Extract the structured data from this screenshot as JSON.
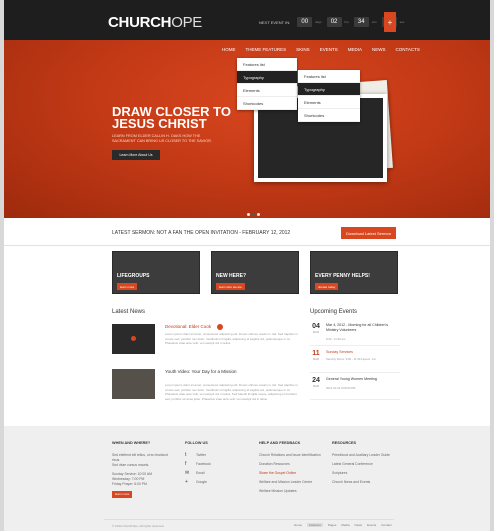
{
  "header": {
    "logo_bold": "CHURCH",
    "logo_light": "OPE",
    "next_event_label": "NEXT EVENT IN:",
    "countdown": [
      {
        "value": "00",
        "unit": "days"
      },
      {
        "value": "02",
        "unit": "hrs"
      },
      {
        "value": "34",
        "unit": "min"
      },
      {
        "value": "11",
        "unit": "sec"
      }
    ],
    "plus_label": "+"
  },
  "nav": {
    "items": [
      "HOME",
      "THEME FEATURES",
      "SKINS",
      "EVENTS",
      "MEDIA",
      "NEWS",
      "CONTACTS"
    ]
  },
  "dropdown1": [
    "Features list",
    "Typography",
    "Elements",
    "Shortcodes"
  ],
  "dropdown2": [
    "Features list",
    "Typography",
    "Elements",
    "Shortcodes"
  ],
  "hero": {
    "title": "DRAW CLOSER TO JESUS CHRIST",
    "subtitle": "LEARN FROM ELDER CALLIN H. OAKS HOW THE SACRAMENT CAN BRING US CLOSER TO THE SAVIOR.",
    "button": "Learn More About Us"
  },
  "sermon": {
    "text": "LATEST SERMON: NOT A FAN THE OPEN INVITATION - FEBRUARY 12, 2012",
    "button": "Download Latest Sermon"
  },
  "boxes": [
    {
      "title": "LIFEGROUPS",
      "button": "learn more"
    },
    {
      "title": "NEW HERE?",
      "button": "learn who we are"
    },
    {
      "title": "EVERY PENNY HELPS!",
      "button": "donate today"
    }
  ],
  "news": {
    "title": "Latest News",
    "items": [
      {
        "title": "Devotional: Elder Cook",
        "text": "Lorem ipsum dolor sit amet, consectetur adipiscing elit. Donec ultrices mauris in nisl. Sed dapibus in ornare sed, porttitor nec dolor. Vestibulum fringilla, adipiscing id sagittis dui, pellentesque in mi. Phasellus vitae ante velit, vel suscipit dui in tellus."
      },
      {
        "title": "Youth Video: Your Day for a Mission",
        "text": "Lorem ipsum dolor sit amet, consectetur adipiscing elit. Donec ultrices mauris in nisl. Sed dapibus in ornare sed, porttitor nec dolor. Vestibulum fringilla, adipiscing id sagittis dui, pellentesque in mi. Phasellus vitae ante velit, vel suscipit dui in tellus. Sed blandit fringilla neque, adipiscing et tincidunt sed, porttitor sit amet justo. Phasellus vitae ante velit, vel suscipit dui in tellus."
      }
    ]
  },
  "events": {
    "title": "Upcoming Events",
    "items": [
      {
        "day": "04",
        "month": "MAR",
        "title": "Mar 4, 2012 - Morning for all Children's Ministry Volunteers",
        "sub": "9:00 - 11:30 am",
        "red": false
      },
      {
        "day": "11",
        "month": "MAR",
        "title": "Sunday Services",
        "sub": "Sanctity Room, 9:00 - 11:30 Lipsum, CA",
        "red": true
      },
      {
        "day": "24",
        "month": "MAR",
        "title": "General Young Women Meeting",
        "sub": "2012-02-24 6:00:00 PM",
        "red": false
      }
    ]
  },
  "footer": {
    "col1": {
      "title": "WHEN AND WHERE?",
      "lines": [
        "Sed eleifend elit tellus, ut eu tincidunt risus.",
        "Sed vitae cursus mauris.",
        "Sunday Service: 10:00 AM",
        "Wednesday: 7:00 PM",
        "Friday Prayer: 6:00 PM"
      ],
      "button": "learn more"
    },
    "col2": {
      "title": "FOLLOW US",
      "items": [
        {
          "icon": "twitter-icon",
          "glyph": "t",
          "label": "Twitter"
        },
        {
          "icon": "facebook-icon",
          "glyph": "f",
          "label": "Facebook"
        },
        {
          "icon": "email-icon",
          "glyph": "✉",
          "label": "Email"
        },
        {
          "icon": "googleplus-icon",
          "glyph": "+",
          "label": "Google"
        }
      ]
    },
    "col3": {
      "title": "HELP AND FEEDBACK",
      "items": [
        "Church Relations and Issue Identification",
        "Donation Resources",
        "Share the Gospel Online",
        "Welfare and Mission Leader Centre",
        "Welfare Mission Updates"
      ]
    },
    "col4": {
      "title": "RESOURCES",
      "items": [
        "Priesthood and Auxiliary Leader Guide",
        "Latest General Conference",
        "Scriptures",
        "Church News and Events"
      ]
    },
    "copyright": "© 2012 ChurchOpe. All rights reserved.",
    "links": [
      "Home",
      "Features",
      "Pages",
      "Media",
      "News",
      "Events",
      "Contact"
    ]
  },
  "colors": {
    "accent": "#d8471f",
    "dark": "#1e1e1e"
  }
}
